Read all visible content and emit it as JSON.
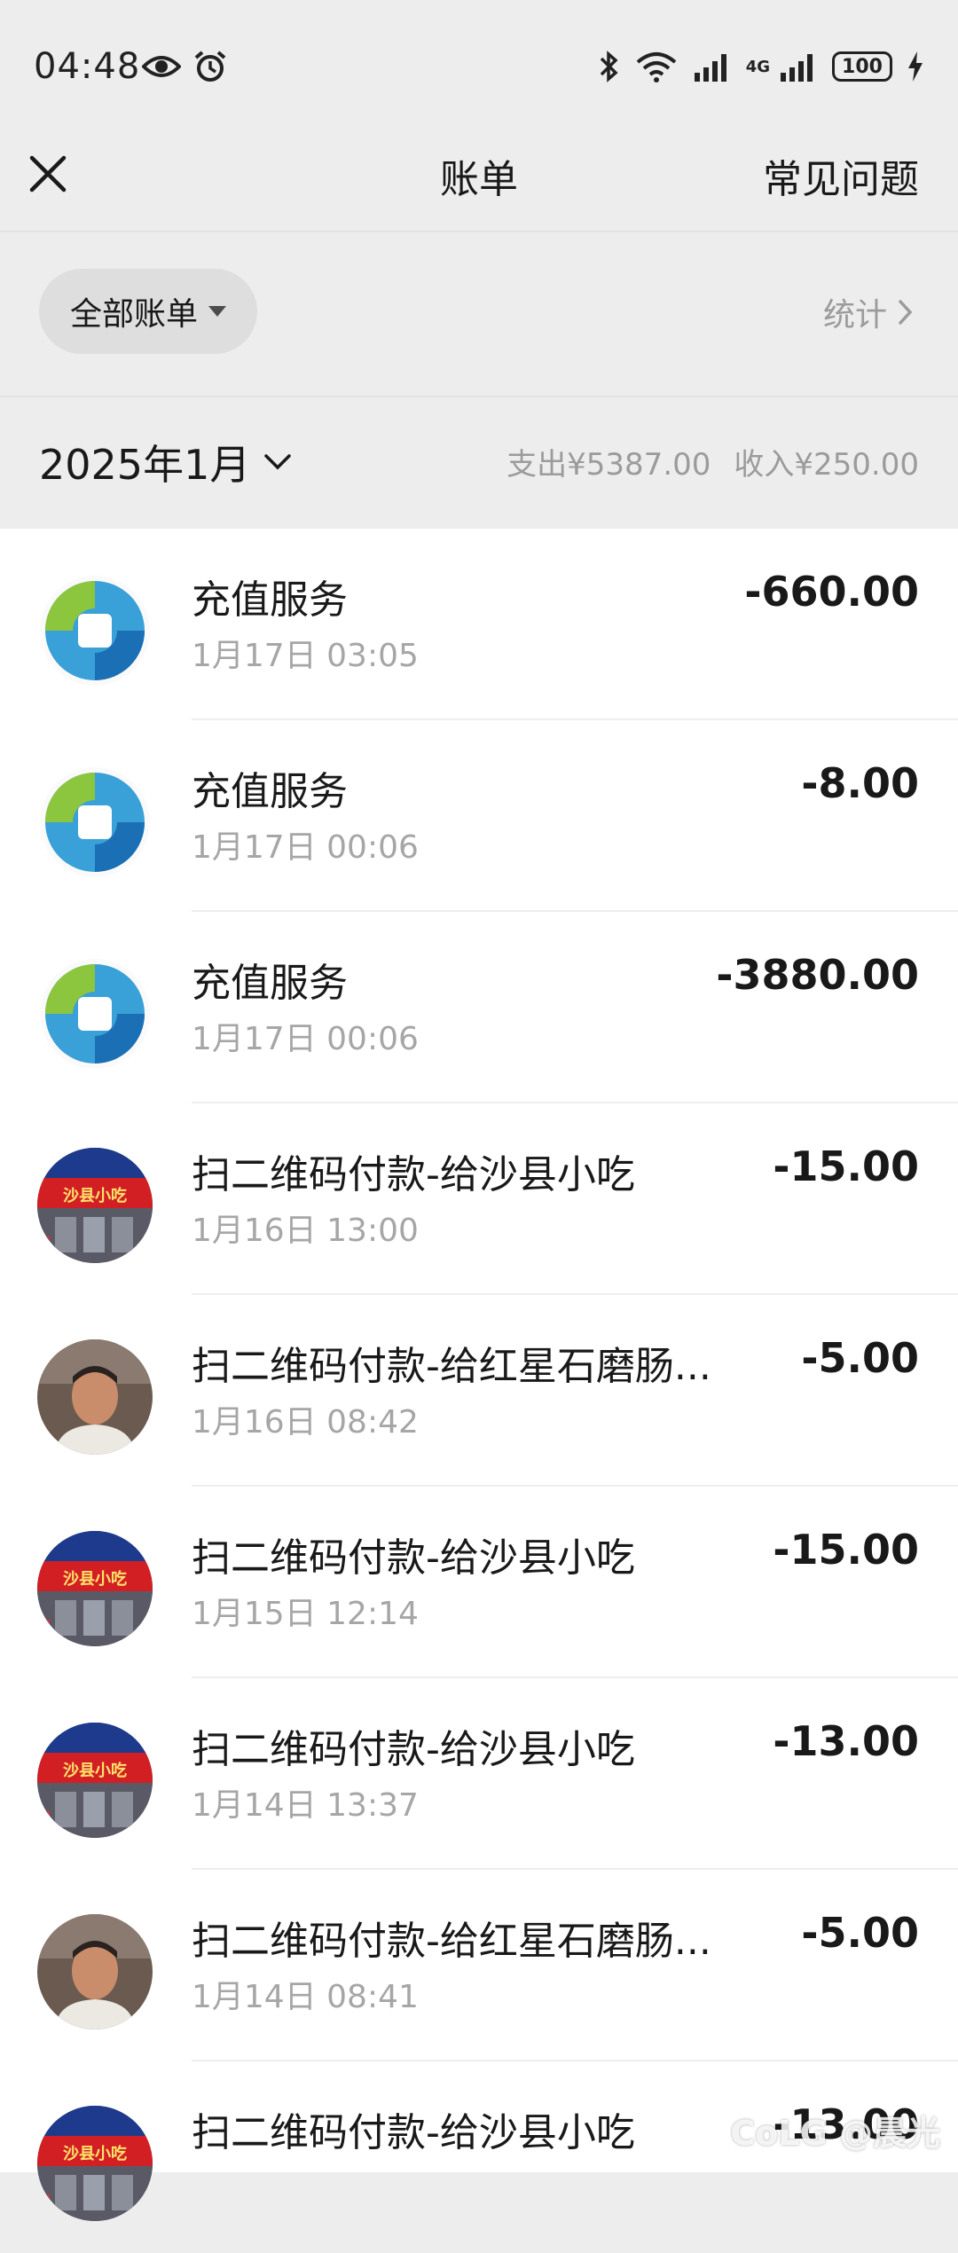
{
  "status_bar": {
    "time": "04:48",
    "network_label": "4G",
    "battery": "100"
  },
  "nav": {
    "title": "账单",
    "faq_label": "常见问题"
  },
  "filter": {
    "label": "全部账单",
    "stats_label": "统计"
  },
  "month": {
    "label": "2025年1月",
    "expense": "支出¥5387.00",
    "income": "收入¥250.00"
  },
  "transactions": [
    {
      "title": "充值服务",
      "time": "1月17日 03:05",
      "amount": "-660.00",
      "avatar": "recharge-logo"
    },
    {
      "title": "充值服务",
      "time": "1月17日 00:06",
      "amount": "-8.00",
      "avatar": "recharge-logo"
    },
    {
      "title": "充值服务",
      "time": "1月17日 00:06",
      "amount": "-3880.00",
      "avatar": "recharge-logo"
    },
    {
      "title": "扫二维码付款-给沙县小吃",
      "time": "1月16日 13:00",
      "amount": "-15.00",
      "avatar": "shaxian-storefront"
    },
    {
      "title": "扫二维码付款-给红星石磨肠...",
      "time": "1月16日 08:42",
      "amount": "-5.00",
      "avatar": "person-portrait"
    },
    {
      "title": "扫二维码付款-给沙县小吃",
      "time": "1月15日 12:14",
      "amount": "-15.00",
      "avatar": "shaxian-storefront"
    },
    {
      "title": "扫二维码付款-给沙县小吃",
      "time": "1月14日 13:37",
      "amount": "-13.00",
      "avatar": "shaxian-storefront"
    },
    {
      "title": "扫二维码付款-给红星石磨肠...",
      "time": "1月14日 08:41",
      "amount": "-5.00",
      "avatar": "person-portrait"
    },
    {
      "title": "扫二维码付款-给沙县小吃",
      "time": "",
      "amount": "-13.00",
      "avatar": "shaxian-storefront"
    }
  ],
  "avatar_text": "沙县小吃",
  "watermark": "CoLG @晨光"
}
